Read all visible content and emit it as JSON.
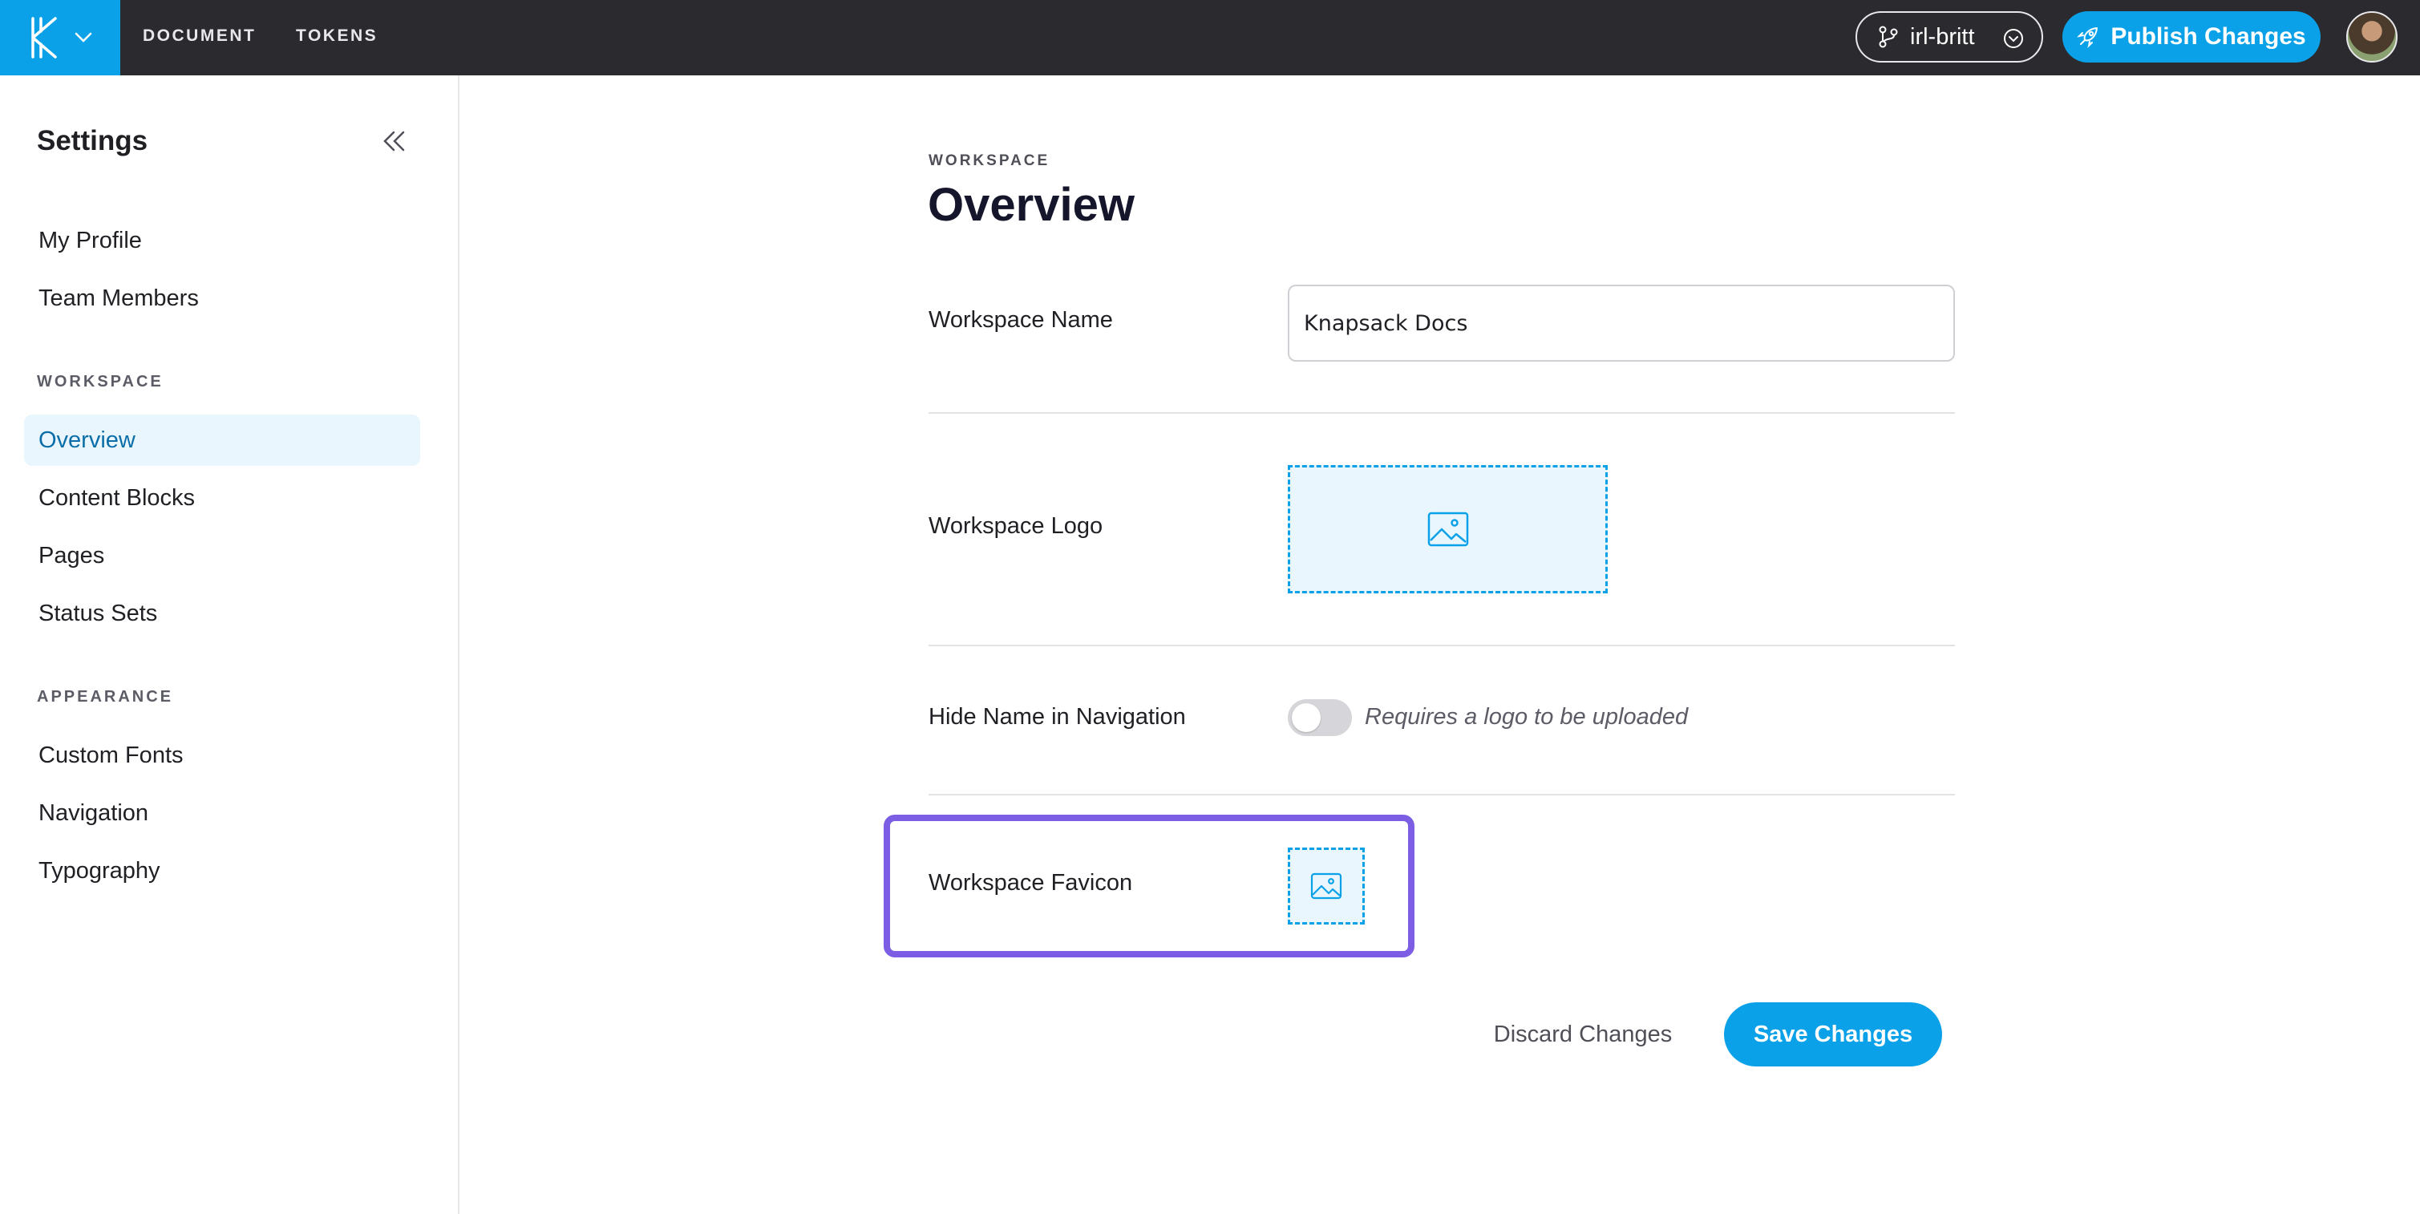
{
  "topbar": {
    "nav": [
      {
        "label": "DOCUMENT"
      },
      {
        "label": "TOKENS"
      }
    ],
    "branch": {
      "label": "irl-britt",
      "icon": "git-branch-icon"
    },
    "publish": {
      "label": "Publish Changes",
      "icon": "rocket-icon"
    },
    "colors": {
      "bar": "#2b2b2f",
      "accent": "#0aa1e8"
    }
  },
  "sidebar": {
    "title": "Settings",
    "items_top": [
      {
        "label": "My Profile"
      },
      {
        "label": "Team Members"
      }
    ],
    "section_workspace": "WORKSPACE",
    "items_workspace": [
      {
        "label": "Overview",
        "active": true
      },
      {
        "label": "Content Blocks"
      },
      {
        "label": "Pages"
      },
      {
        "label": "Status Sets"
      }
    ],
    "section_appearance": "APPEARANCE",
    "items_appearance": [
      {
        "label": "Custom Fonts"
      },
      {
        "label": "Navigation"
      },
      {
        "label": "Typography"
      }
    ]
  },
  "main": {
    "eyebrow": "WORKSPACE",
    "title": "Overview",
    "rows": {
      "name": {
        "label": "Workspace Name",
        "value": "Knapsack Docs"
      },
      "logo": {
        "label": "Workspace Logo"
      },
      "hide_name": {
        "label": "Hide Name in Navigation",
        "hint": "Requires a logo to be uploaded",
        "enabled": false
      },
      "favicon": {
        "label": "Workspace Favicon"
      }
    },
    "actions": {
      "discard": "Discard Changes",
      "save": "Save Changes"
    },
    "highlight_color": "#7b5ee3"
  }
}
